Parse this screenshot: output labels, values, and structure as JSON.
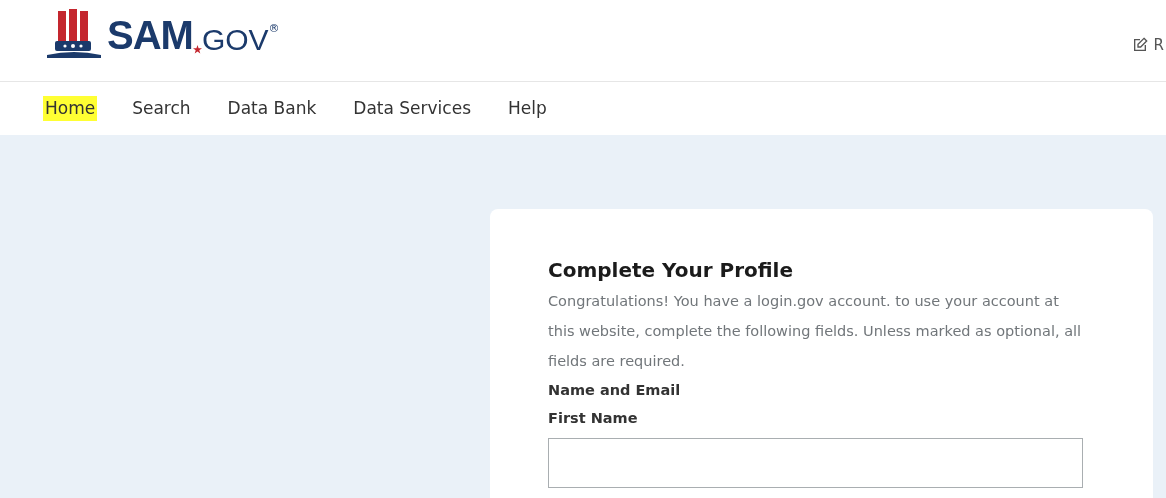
{
  "header": {
    "logo": {
      "bold": "SAM",
      "light": "GOV",
      "mark": "®"
    },
    "action_label": "R"
  },
  "nav": [
    {
      "label": "Home",
      "selected": true
    },
    {
      "label": "Search",
      "selected": false
    },
    {
      "label": "Data Bank",
      "selected": false
    },
    {
      "label": "Data Services",
      "selected": false
    },
    {
      "label": "Help",
      "selected": false
    }
  ],
  "card": {
    "title": "Complete Your Profile",
    "intro": "Congratulations! You have a login.gov account. to use your account at this website, complete the following fields. Unless marked as optional, all fields are required.",
    "section": "Name and Email",
    "field_label": "First Name"
  }
}
